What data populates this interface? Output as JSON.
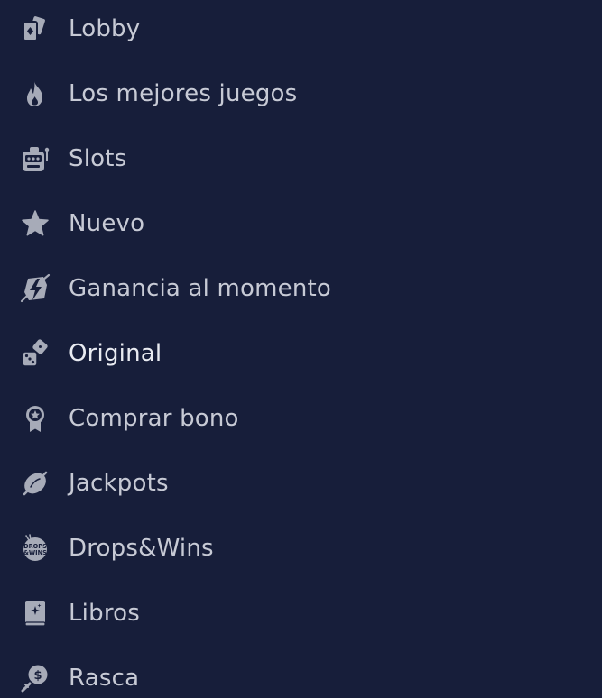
{
  "menu": {
    "items": [
      {
        "label": "Lobby",
        "icon": "cards-icon"
      },
      {
        "label": "Los mejores juegos",
        "icon": "fire-icon"
      },
      {
        "label": "Slots",
        "icon": "slot-machine-icon"
      },
      {
        "label": "Nuevo",
        "icon": "star-icon"
      },
      {
        "label": "Ganancia al momento",
        "icon": "instant-win-icon"
      },
      {
        "label": "Original",
        "icon": "dice-icon"
      },
      {
        "label": "Comprar bono",
        "icon": "award-badge-icon"
      },
      {
        "label": "Jackpots",
        "icon": "lemon-icon"
      },
      {
        "label": "Drops&Wins",
        "icon": "drops-wins-icon",
        "icon_text_1": "DROPS",
        "icon_text_2": "&WINS"
      },
      {
        "label": "Libros",
        "icon": "book-icon"
      },
      {
        "label": "Rasca",
        "icon": "scratch-coin-icon"
      }
    ]
  },
  "colors": {
    "background": "#171e3a",
    "icon": "#a7abb8",
    "text": "#c7cad5",
    "active_text": "#e9ebf1"
  }
}
